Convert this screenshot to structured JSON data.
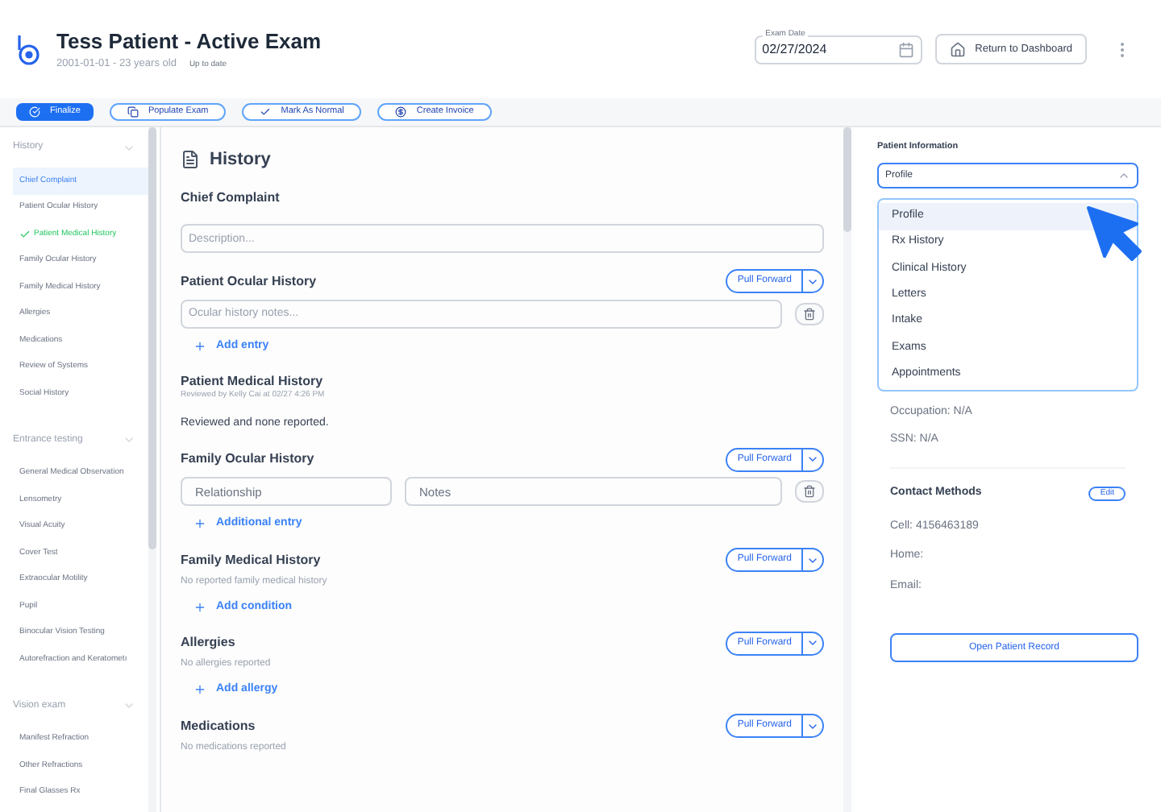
{
  "header": {
    "title": "Tess Patient - Active Exam",
    "dob": "2001-01-01 - 23 years old",
    "status": "Up to date",
    "exam_date": {
      "label": "Exam Date",
      "value": "02/27/2024"
    },
    "return_button": "Return to Dashboard"
  },
  "toolbar": [
    {
      "label": "Finalize",
      "kind": "primary"
    },
    {
      "label": "Populate Exam",
      "kind": "outline"
    },
    {
      "label": "Mark As Normal",
      "kind": "outline"
    },
    {
      "label": "Create Invoice",
      "kind": "outline"
    }
  ],
  "sidebar": [
    {
      "title": "History",
      "expanded": true,
      "items": [
        {
          "label": "Chief Complaint",
          "selected": true,
          "done": false
        },
        {
          "label": "Patient Ocular History",
          "selected": false,
          "done": false
        },
        {
          "label": "Patient Medical History",
          "selected": false,
          "done": true
        },
        {
          "label": "Family Ocular History",
          "selected": false,
          "done": false
        },
        {
          "label": "Family Medical History",
          "selected": false,
          "done": false
        },
        {
          "label": "Allergies",
          "selected": false,
          "done": false
        },
        {
          "label": "Medications",
          "selected": false,
          "done": false
        },
        {
          "label": "Review of Systems",
          "selected": false,
          "done": false
        },
        {
          "label": "Social History",
          "selected": false,
          "done": false
        }
      ]
    },
    {
      "title": "Entrance testing",
      "expanded": true,
      "items": [
        {
          "label": "General Medical Observation",
          "selected": false,
          "done": false
        },
        {
          "label": "Lensometry",
          "selected": false,
          "done": false
        },
        {
          "label": "Visual Acuity",
          "selected": false,
          "done": false
        },
        {
          "label": "Cover Test",
          "selected": false,
          "done": false
        },
        {
          "label": "Extraocular Motility",
          "selected": false,
          "done": false
        },
        {
          "label": "Pupil",
          "selected": false,
          "done": false
        },
        {
          "label": "Binocular Vision Testing",
          "selected": false,
          "done": false
        },
        {
          "label": "Autorefraction and Keratometı",
          "selected": false,
          "done": false
        }
      ]
    },
    {
      "title": "Vision exam",
      "expanded": true,
      "items": [
        {
          "label": "Manifest Refraction",
          "selected": false,
          "done": false
        },
        {
          "label": "Other Refractions",
          "selected": false,
          "done": false
        },
        {
          "label": "Final Glasses Rx",
          "selected": false,
          "done": false
        }
      ]
    }
  ],
  "main": {
    "title": "History",
    "sections": [
      {
        "kind": "field",
        "title": "Chief Complaint",
        "placeholder": "Description..."
      },
      {
        "kind": "entries",
        "title": "Patient Ocular History",
        "pull_forward": "Pull Forward",
        "placeholder": "Ocular history notes...",
        "add": "Add entry"
      },
      {
        "kind": "reviewed",
        "title": "Patient Medical History",
        "reviewed": "Reviewed by Kelly Cai at 02/27 4:26 PM",
        "body": "Reviewed and none reported."
      },
      {
        "kind": "pair",
        "title": "Family Ocular History",
        "pull_forward": "Pull Forward",
        "placeholder": "Relationship",
        "placeholder_2": "Notes",
        "add": "Additional entry"
      },
      {
        "kind": "empty",
        "title": "Family Medical History",
        "pull_forward": "Pull Forward",
        "empty": "No reported family medical history",
        "add": "Add condition"
      },
      {
        "kind": "empty",
        "title": "Allergies",
        "pull_forward": "Pull Forward",
        "empty": "No allergies reported",
        "add": "Add allergy"
      },
      {
        "kind": "empty",
        "title": "Medications",
        "pull_forward": "Pull Forward",
        "empty": "No medications reported"
      }
    ]
  },
  "patient_info": {
    "title": "Patient Information",
    "select": {
      "value": "Profile",
      "expanded": true
    },
    "options": [
      {
        "label": "Profile",
        "selected": true
      },
      {
        "label": "Rx History",
        "selected": false
      },
      {
        "label": "Clinical History",
        "selected": false
      },
      {
        "label": "Letters",
        "selected": false
      },
      {
        "label": "Intake",
        "selected": false
      },
      {
        "label": "Exams",
        "selected": false
      },
      {
        "label": "Appointments",
        "selected": false
      }
    ],
    "details": [
      "Occupation: N/A",
      "SSN: N/A"
    ],
    "contact": {
      "title": "Contact Methods",
      "edit": "Edit",
      "lines": [
        "Cell: 4156463189",
        "Home:",
        "Email:"
      ]
    },
    "open_record": "Open Patient Record"
  }
}
